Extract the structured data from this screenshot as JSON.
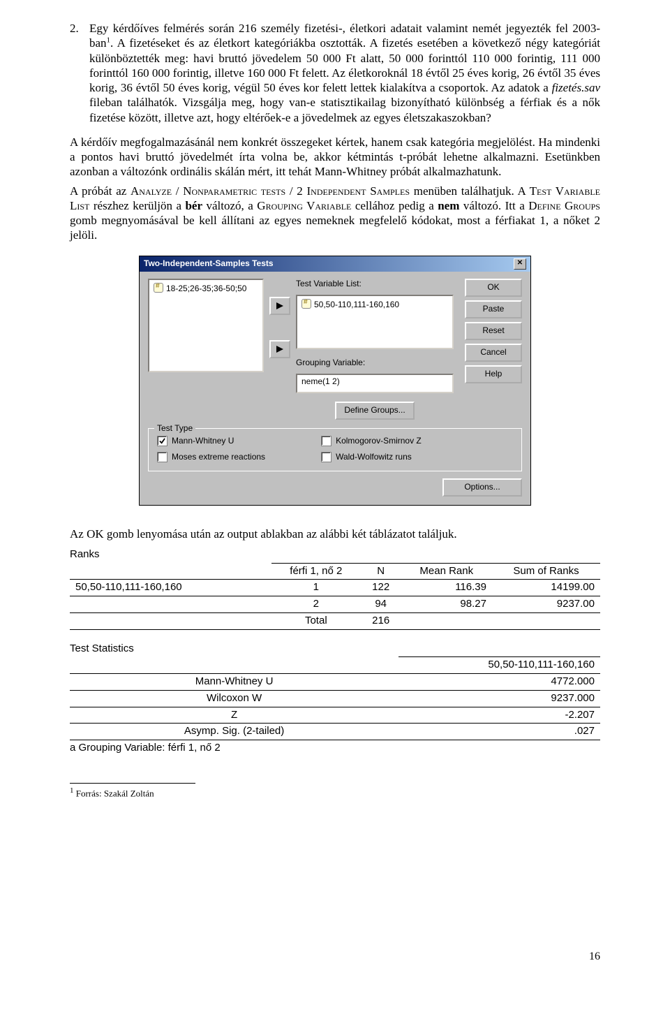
{
  "list": {
    "num": "2.",
    "text_a": "Egy kérdőíves felmérés során 216 személy fizetési-, életkori adatait valamint nemét jegyezték fel 2003-ban",
    "sup": "1",
    "text_b": ". A fizetéseket és az életkort kategóriákba osztották. A fizetés esetében a következő négy kategóriát különböztették meg: havi bruttó jövedelem 50 000 Ft alatt, 50 000 forinttól 110 000 forintig, 111 000 forinttól 160 000 forintig, illetve 160 000 Ft felett. Az életkoroknál 18 évtől 25 éves korig, 26 évtől 35 éves korig, 36 évtől 50 éves korig, végül 50 éves kor felett lettek kialakítva a csoportok. Az adatok a ",
    "italic": "fizetés.sav",
    "text_c": " fileban találhatók. Vizsgálja meg, hogy van-e statisztikailag bizonyítható különbség a férfiak és a nők fizetése között, illetve azt, hogy eltérőek-e a jövedelmek az egyes életszakaszokban?"
  },
  "para2_a": "A kérdőív megfogalmazásánál nem konkrét összegeket kértek, hanem csak kategória megjelölést. Ha mindenki a pontos havi bruttó jövedelmét írta volna be, akkor kétmintás t-próbát lehetne alkalmazni. Esetünkben azonban a változónk ordinális skálán mért, itt tehát Mann-Whitney próbát alkalmazhatunk.",
  "para3": {
    "a": "A próbát az ",
    "sc1": "Analyze / Nonparametric tests / 2 Independent Samples",
    "b": " menüben találhatjuk. A ",
    "sc2": "Test Variable List",
    "c": " részhez kerüljön a ",
    "bold1": "bér",
    "d": " változó, a ",
    "sc3": "Grouping Variable",
    "e": " cellához pedig a ",
    "bold2": "nem",
    "f": " változó. Itt a ",
    "sc4": "Define Groups",
    "g": " gomb megnyomásával be kell állítani az egyes nemeknek megfelelő kódokat, most a férfiakat 1, a nőket 2 jelöli."
  },
  "dlg": {
    "title": "Two-Independent-Samples Tests",
    "left_item": "18-25;26-35;36-50;50",
    "tvl_label": "Test Variable List:",
    "tvl_value": "50,50-110,111-160,160",
    "grp_label": "Grouping Variable:",
    "grp_value": "neme(1 2)",
    "define_btn": "Define Groups...",
    "tt_legend": "Test Type",
    "chk_mw": "Mann-Whitney U",
    "chk_ks": "Kolmogorov-Smirnov Z",
    "chk_moses": "Moses extreme reactions",
    "chk_ww": "Wald-Wolfowitz runs",
    "options_btn": "Options...",
    "btns": {
      "ok": "OK",
      "paste": "Paste",
      "reset": "Reset",
      "cancel": "Cancel",
      "help": "Help"
    }
  },
  "after_dlg": "Az OK gomb lenyomása után az output ablakban az alábbi két táblázatot találjuk.",
  "ranks": {
    "title": "Ranks",
    "headers": {
      "g": "férfi 1, nő 2",
      "n": "N",
      "mean": "Mean Rank",
      "sum": "Sum of Ranks"
    },
    "row_label": "50,50-110,111-160,160",
    "rows": [
      {
        "g": "1",
        "n": "122",
        "mean": "116.39",
        "sum": "14199.00"
      },
      {
        "g": "2",
        "n": "94",
        "mean": "98.27",
        "sum": "9237.00"
      },
      {
        "g": "Total",
        "n": "216",
        "mean": "",
        "sum": ""
      }
    ]
  },
  "stats": {
    "title": "Test Statistics",
    "col": "50,50-110,111-160,160",
    "rows": [
      {
        "l": "Mann-Whitney U",
        "v": "4772.000"
      },
      {
        "l": "Wilcoxon W",
        "v": "9237.000"
      },
      {
        "l": "Z",
        "v": "-2.207"
      },
      {
        "l": "Asymp. Sig. (2-tailed)",
        "v": ".027"
      }
    ],
    "foot": "a  Grouping Variable: férfi 1, nő 2"
  },
  "footnote": {
    "mark": "1",
    "text": " Forrás: Szakál Zoltán"
  },
  "page_num": "16"
}
